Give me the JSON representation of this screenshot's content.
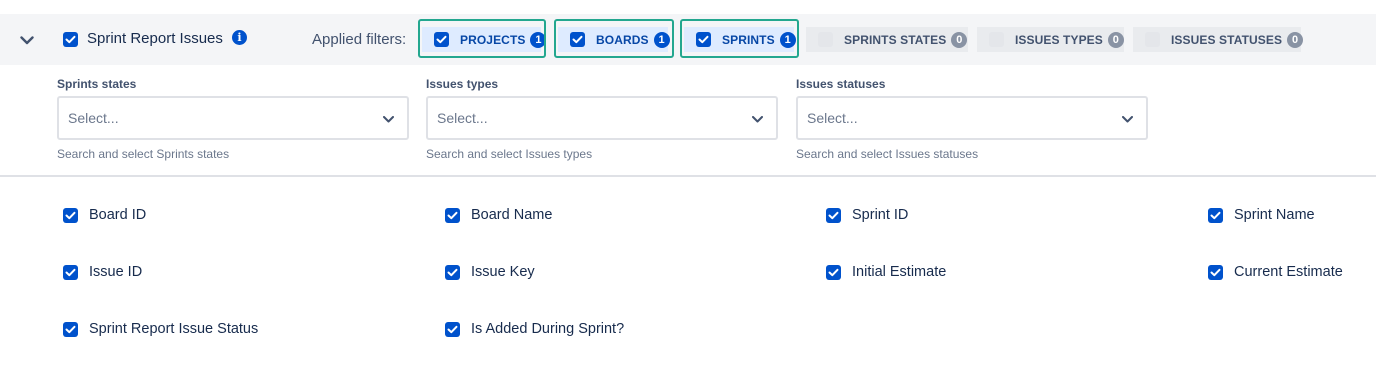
{
  "header": {
    "title": "Sprint Report Issues",
    "info_icon": "info-icon",
    "applied_filters_label": "Applied filters:",
    "accent_color": "#0052cc",
    "highlight_color": "#23a78f",
    "filter_chips": [
      {
        "label": "PROJECTS",
        "count": "1",
        "checked": true
      },
      {
        "label": "BOARDS",
        "count": "1",
        "checked": true
      },
      {
        "label": "SPRINTS",
        "count": "1",
        "checked": true
      },
      {
        "label": "SPRINTS STATES",
        "count": "0",
        "checked": false
      },
      {
        "label": "ISSUES TYPES",
        "count": "0",
        "checked": false
      },
      {
        "label": "ISSUES STATUSES",
        "count": "0",
        "checked": false
      }
    ]
  },
  "filters": [
    {
      "label": "Sprints states",
      "placeholder": "Select...",
      "help": "Search and select Sprints states"
    },
    {
      "label": "Issues types",
      "placeholder": "Select...",
      "help": "Search and select Issues types"
    },
    {
      "label": "Issues statuses",
      "placeholder": "Select...",
      "help": "Search and select Issues statuses"
    }
  ],
  "columns": [
    {
      "label": "Board ID",
      "checked": true
    },
    {
      "label": "Board Name",
      "checked": true
    },
    {
      "label": "Sprint ID",
      "checked": true
    },
    {
      "label": "Sprint Name",
      "checked": true
    },
    {
      "label": "Issue ID",
      "checked": true
    },
    {
      "label": "Issue Key",
      "checked": true
    },
    {
      "label": "Initial Estimate",
      "checked": true
    },
    {
      "label": "Current Estimate",
      "checked": true
    },
    {
      "label": "Sprint Report Issue Status",
      "checked": true
    },
    {
      "label": "Is Added During Sprint?",
      "checked": true
    }
  ]
}
